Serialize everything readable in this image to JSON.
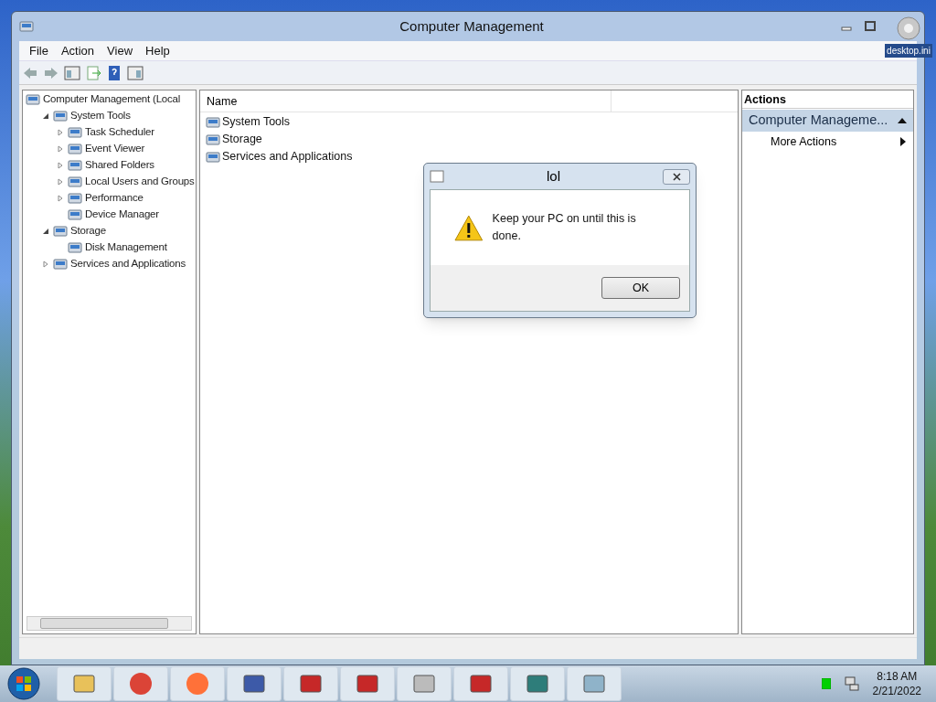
{
  "desktop": {
    "icon_label": "desktop.ini"
  },
  "window": {
    "title": "Computer Management"
  },
  "menu": [
    "File",
    "Action",
    "View",
    "Help"
  ],
  "tree": [
    {
      "label": "Computer Management (Local",
      "children": [
        {
          "label": "System Tools",
          "expanded": true,
          "children": [
            {
              "label": "Task Scheduler",
              "expanded": false
            },
            {
              "label": "Event Viewer",
              "expanded": false
            },
            {
              "label": "Shared Folders",
              "expanded": false
            },
            {
              "label": "Local Users and Groups",
              "expanded": false
            },
            {
              "label": "Performance",
              "expanded": false
            },
            {
              "label": "Device Manager"
            }
          ]
        },
        {
          "label": "Storage",
          "expanded": true,
          "children": [
            {
              "label": "Disk Management"
            }
          ]
        },
        {
          "label": "Services and Applications",
          "expanded": false
        }
      ]
    }
  ],
  "list": {
    "columns": [
      "Name"
    ],
    "rows": [
      "System Tools",
      "Storage",
      "Services and Applications"
    ]
  },
  "actions": {
    "title": "Actions",
    "section": "Computer Manageme...",
    "items": [
      "More Actions"
    ]
  },
  "dialog": {
    "title": "lol",
    "message": "Keep your PC on until this is done.",
    "button": "OK"
  },
  "clock": {
    "time": "8:18 AM",
    "date": "2/21/2022"
  }
}
